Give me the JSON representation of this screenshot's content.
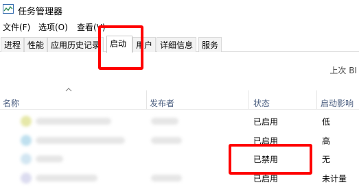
{
  "window": {
    "title": "任务管理器"
  },
  "menu": [
    "文件(F)",
    "选项(O)",
    "查看(V)"
  ],
  "tabs": [
    "进程",
    "性能",
    "应用历史记录",
    "启动",
    "用户",
    "详细信息",
    "服务"
  ],
  "active_tab": "启动",
  "last_bios": "上次 BI",
  "columns": {
    "name": "名称",
    "publisher": "发布者",
    "status": "状态",
    "impact": "启动影响"
  },
  "rows": [
    {
      "status": "已启用",
      "impact": "低"
    },
    {
      "status": "已启用",
      "impact": "高"
    },
    {
      "status": "已禁用",
      "impact": "无"
    },
    {
      "status": "已启用",
      "impact": "未计量"
    }
  ],
  "colors": {
    "highlight": "#ff0000",
    "header_text": "#4d6082"
  }
}
